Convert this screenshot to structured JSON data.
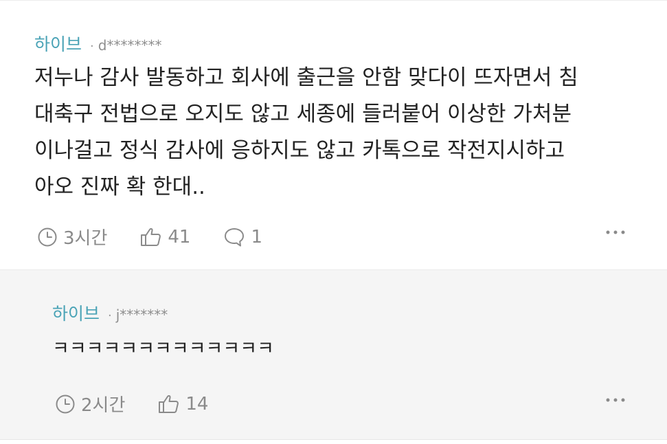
{
  "comments": [
    {
      "author": "하이브",
      "separator": "·",
      "user_id": "d********",
      "body": "저누나 감사 발동하고 회사에 출근을 안함 맞다이 뜨자면서 침\n대축구 전법으로 오지도 않고 세종에 들러붙어 이상한 가처분\n이나걸고 정식 감사에 응하지도 않고 카톡으로 작전지시하고\n아오 진짜 확 한대..",
      "time": "3시간",
      "likes": "41",
      "replies": "1",
      "icons": [
        "clock-icon",
        "thumbs-up-icon",
        "speech-bubble-icon",
        "more-icon"
      ]
    },
    {
      "author": "하이브",
      "separator": "·",
      "user_id": "j*******",
      "body": "ㅋㅋㅋㅋㅋㅋㅋㅋㅋㅋㅋㅋㅋ",
      "time": "2시간",
      "likes": "14",
      "icons": [
        "clock-icon",
        "thumbs-up-icon",
        "more-icon"
      ]
    }
  ],
  "colors": {
    "author": "#4aa3b6",
    "text": "#222222",
    "muted": "#8a8a8a",
    "reply_background": "#f5f5f5"
  }
}
